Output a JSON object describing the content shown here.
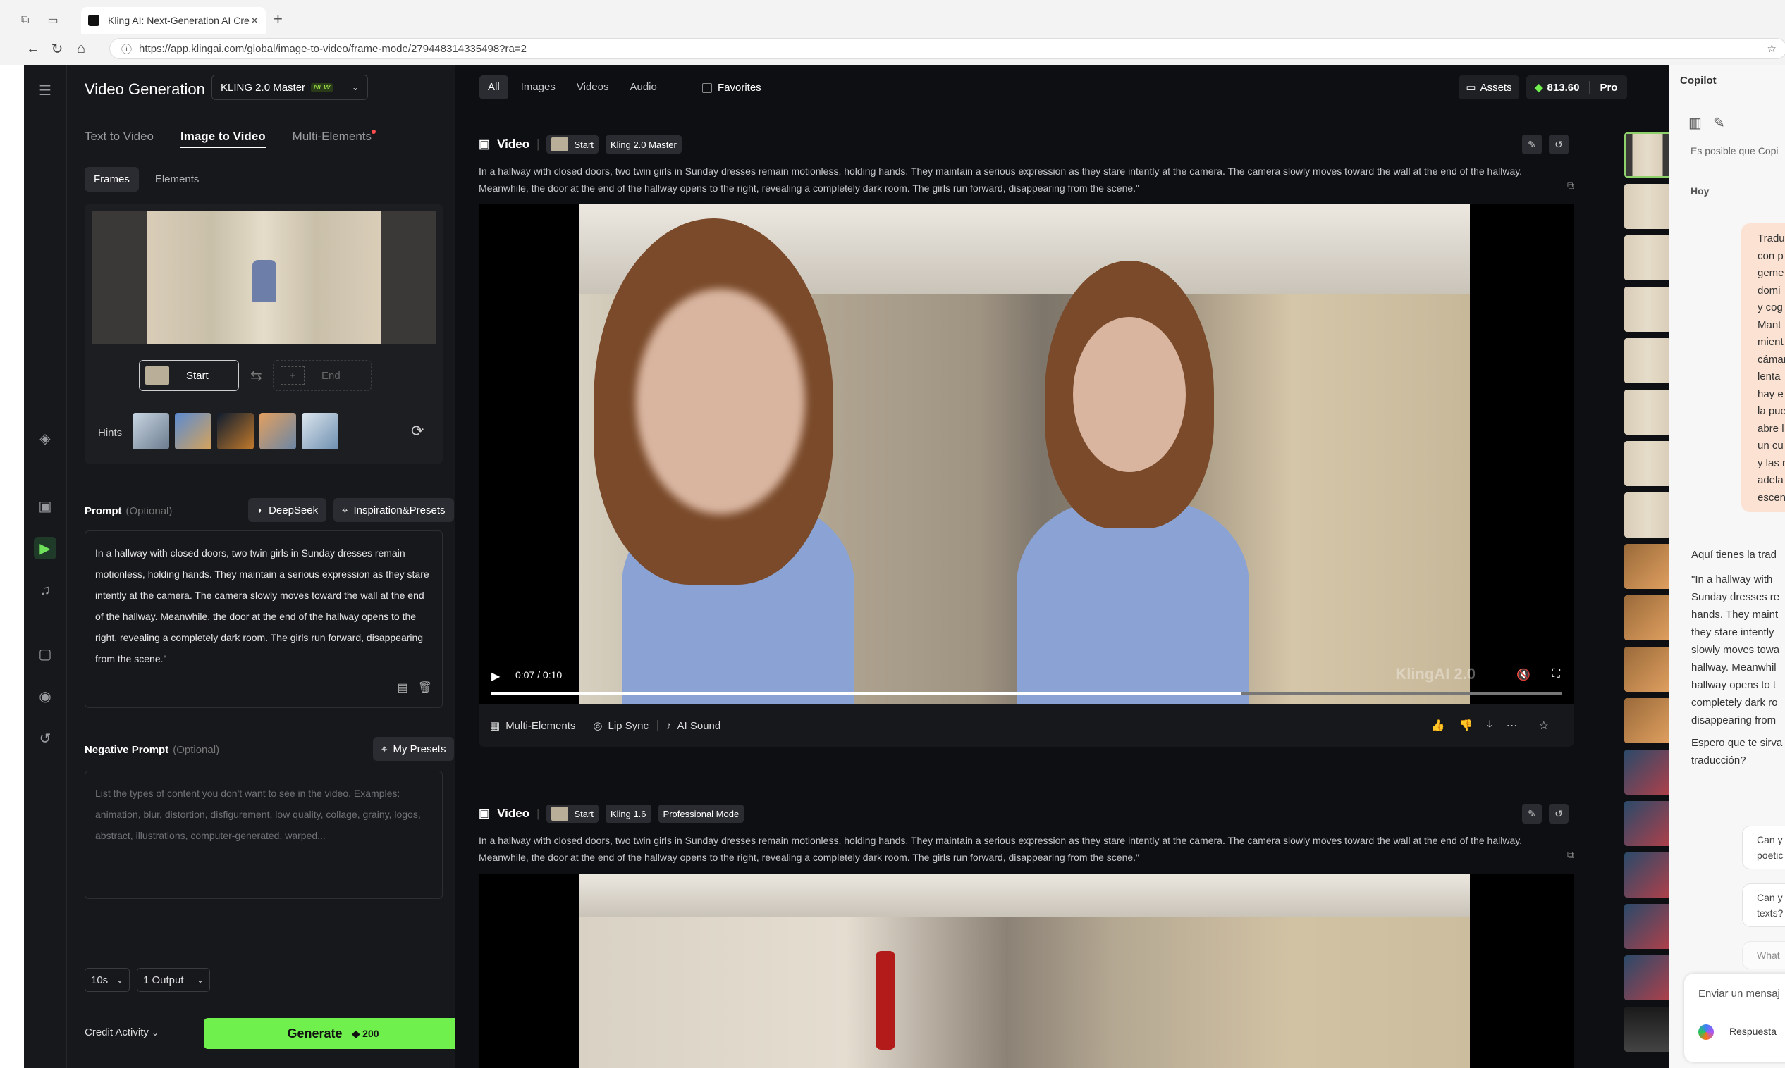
{
  "browser": {
    "tab_title": "Kling AI: Next-Generation AI Cre",
    "url": "https://app.klingai.com/global/image-to-video/frame-mode/279448314335498?ra=2"
  },
  "left": {
    "title": "Video Generation",
    "model": "KLING 2.0 Master",
    "model_badge": "NEW",
    "modes": [
      "Text to Video",
      "Image to Video",
      "Multi-Elements"
    ],
    "subtabs": [
      "Frames",
      "Elements"
    ],
    "start_label": "Start",
    "end_label": "End",
    "hints_label": "Hints",
    "prompt_label": "Prompt",
    "optional": "(Optional)",
    "deepseek": "DeepSeek",
    "inspiration": "Inspiration&Presets",
    "prompt_text": "In a hallway with closed doors, two twin girls in Sunday dresses remain motionless, holding hands. They maintain a serious expression as they stare intently at the camera. The camera slowly moves toward the wall at the end of the hallway. Meanwhile, the door at the end of the hallway opens to the right, revealing a completely dark room. The girls run forward, disappearing from the scene.\"",
    "neg_label": "Negative Prompt",
    "my_presets": "My Presets",
    "neg_placeholder": "List the types of content you don't want to see in the video. Examples: animation, blur, distortion, disfigurement, low quality, collage, grainy, logos, abstract, illustrations, computer-generated, warped...",
    "duration": "10s",
    "outputs": "1 Output",
    "credit_activity": "Credit Activity",
    "generate": "Generate",
    "generate_cost": "200"
  },
  "top": {
    "filters": [
      "All",
      "Images",
      "Videos",
      "Audio"
    ],
    "favorites": "Favorites",
    "assets": "Assets",
    "credits": "813.60",
    "plan": "Pro"
  },
  "videos": [
    {
      "heading": "Video",
      "tags": [
        "Start",
        "Kling 2.0 Master"
      ],
      "description": "In a hallway with closed doors, two twin girls in Sunday dresses remain motionless, holding hands. They maintain a serious expression as they stare intently at the camera. The camera slowly moves toward the wall at the end of the hallway. Meanwhile, the door at the end of the hallway opens to the right, revealing a completely dark room. The girls run forward, disappearing from the scene.\"",
      "time": "0:07 / 0:10",
      "progress": 0.7,
      "watermark": "KlingAI 2.0",
      "tools": [
        "Multi-Elements",
        "Lip Sync",
        "AI Sound"
      ]
    },
    {
      "heading": "Video",
      "tags": [
        "Start",
        "Kling 1.6",
        "Professional Mode"
      ],
      "description": "In a hallway with closed doors, two twin girls in Sunday dresses remain motionless, holding hands. They maintain a serious expression as they stare intently at the camera. The camera slowly moves toward the wall at the end of the hallway. Meanwhile, the door at the end of the hallway opens to the right, revealing a completely dark room. The girls run forward, disappearing from the scene.\""
    }
  ],
  "copilot": {
    "title": "Copilot",
    "subtitle": "Es posible que Copi",
    "today": "Hoy",
    "user_lines": [
      "Tradu",
      "con p",
      "geme",
      "domi",
      "y cog",
      "Mant",
      "mient",
      "cámar",
      "lenta",
      "hay e",
      "la pue",
      "abre l",
      "un cu",
      "y las r",
      "adela",
      "escen"
    ],
    "reply_intro": "Aquí tienes la trad",
    "reply_lines": [
      "\"In a hallway with",
      "Sunday dresses re",
      "hands. They maint",
      "they stare intently",
      "slowly moves towa",
      "hallway. Meanwhil",
      "hallway opens to t",
      "completely dark ro",
      "disappearing from"
    ],
    "closing_lines": [
      "Espero que te sirva",
      "traducción?"
    ],
    "suggestions": [
      [
        "Can y",
        "poetic"
      ],
      [
        "Can y",
        "texts?"
      ],
      [
        "What",
        ""
      ]
    ],
    "input_placeholder": "Enviar un mensaj",
    "mode": "Respuesta"
  }
}
